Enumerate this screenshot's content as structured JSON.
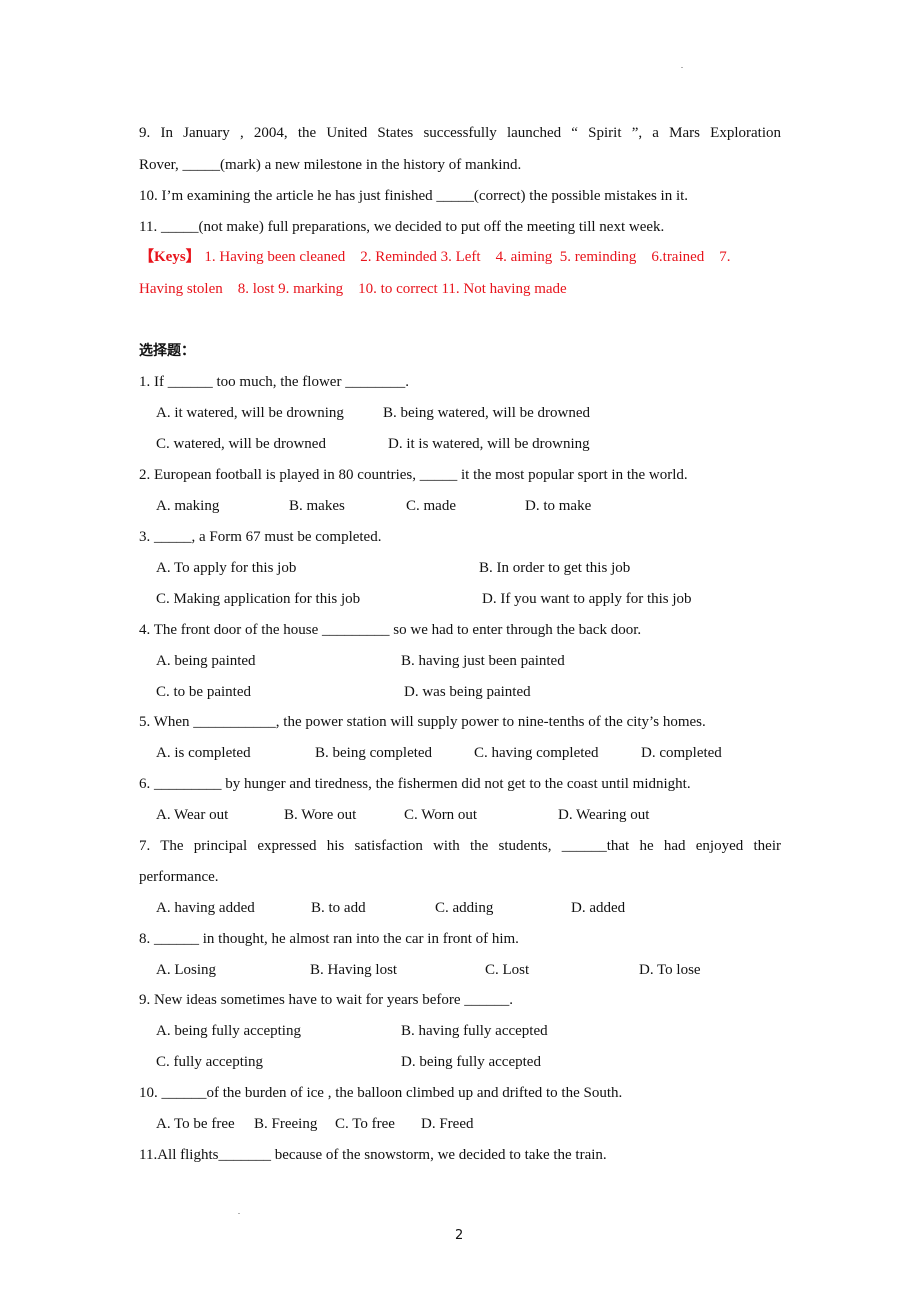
{
  "fill_in": {
    "q9": {
      "line1": "9. In January , 2004, the United States successfully launched “ Spirit ”, a Mars Exploration",
      "line2": "Rover, _____(mark) a new milestone in the history of mankind."
    },
    "q10": "10. I’m examining the article he has just finished _____(correct) the possible mistakes in it.",
    "q11": "11. _____(not make) full preparations, we decided to put off the meeting till next week.",
    "keys": {
      "label": "【Keys】",
      "line1": "1. Having been cleaned    2. Reminded 3. Left    4. aiming  5. reminding    6.trained    7.",
      "line2": "Having stolen    8. lost 9. marking    10. to correct 11. Not having made"
    }
  },
  "multiple_choice": {
    "heading": "选择题：",
    "questions": [
      {
        "stem": "1. If ______ too much, the flower ________.",
        "options": [
          "A. it watered, will be drowning",
          "B. being watered, will be drowned",
          "C. watered, will be drowned",
          "D. it is watered, will be drowning"
        ]
      },
      {
        "stem": "2. European football is played in 80 countries, _____ it the most popular sport in the world.",
        "options": [
          "A. making",
          "B. makes",
          "C. made",
          "D. to make"
        ]
      },
      {
        "stem": "3. _____, a Form 67 must be completed.",
        "options": [
          "A. To apply for this job",
          "B. In order to get this job",
          "C. Making application for this job",
          "D. If you want to apply for this job"
        ]
      },
      {
        "stem": "4. The front door of the house _________ so we had to enter through the back door.",
        "options": [
          "A. being painted",
          "B. having just been painted",
          "C. to be painted",
          "D. was being painted"
        ]
      },
      {
        "stem": "5. When ___________, the power station will supply power to nine-tenths of the city’s homes.",
        "options": [
          "A. is completed",
          "B. being completed",
          "C. having completed",
          "D. completed"
        ]
      },
      {
        "stem": "6. _________ by hunger and tiredness, the fishermen did not get to the coast until midnight.",
        "options": [
          "A. Wear out",
          "B. Wore out",
          "C. Worn out",
          "D. Wearing out"
        ]
      },
      {
        "stem_line1": "7. The principal expressed his satisfaction with the students, ______that he had enjoyed their",
        "stem_line2": "performance.",
        "options": [
          "A. having added",
          "B. to add",
          "C. adding",
          "D. added"
        ]
      },
      {
        "stem": "8. ______ in thought, he almost ran into the car in front of him.",
        "options": [
          "A. Losing",
          "B. Having lost",
          "C. Lost",
          "D. To lose"
        ]
      },
      {
        "stem": "9. New ideas sometimes have to wait for years before ______.",
        "options": [
          "A. being fully accepting",
          "B. having fully accepted",
          "C. fully accepting",
          "D. being fully accepted"
        ]
      },
      {
        "stem": "10. ______of the burden of ice , the balloon climbed up and drifted to the South.",
        "options": [
          "A. To be free",
          "B. Freeing",
          "C. To free",
          "D. Freed"
        ]
      },
      {
        "stem": "11.All flights_______ because of the snowstorm, we decided to take the train."
      }
    ]
  },
  "footer": {
    "page_number": "2"
  },
  "colors": {
    "key_text": "#e8141c",
    "body_text": "#111111"
  }
}
